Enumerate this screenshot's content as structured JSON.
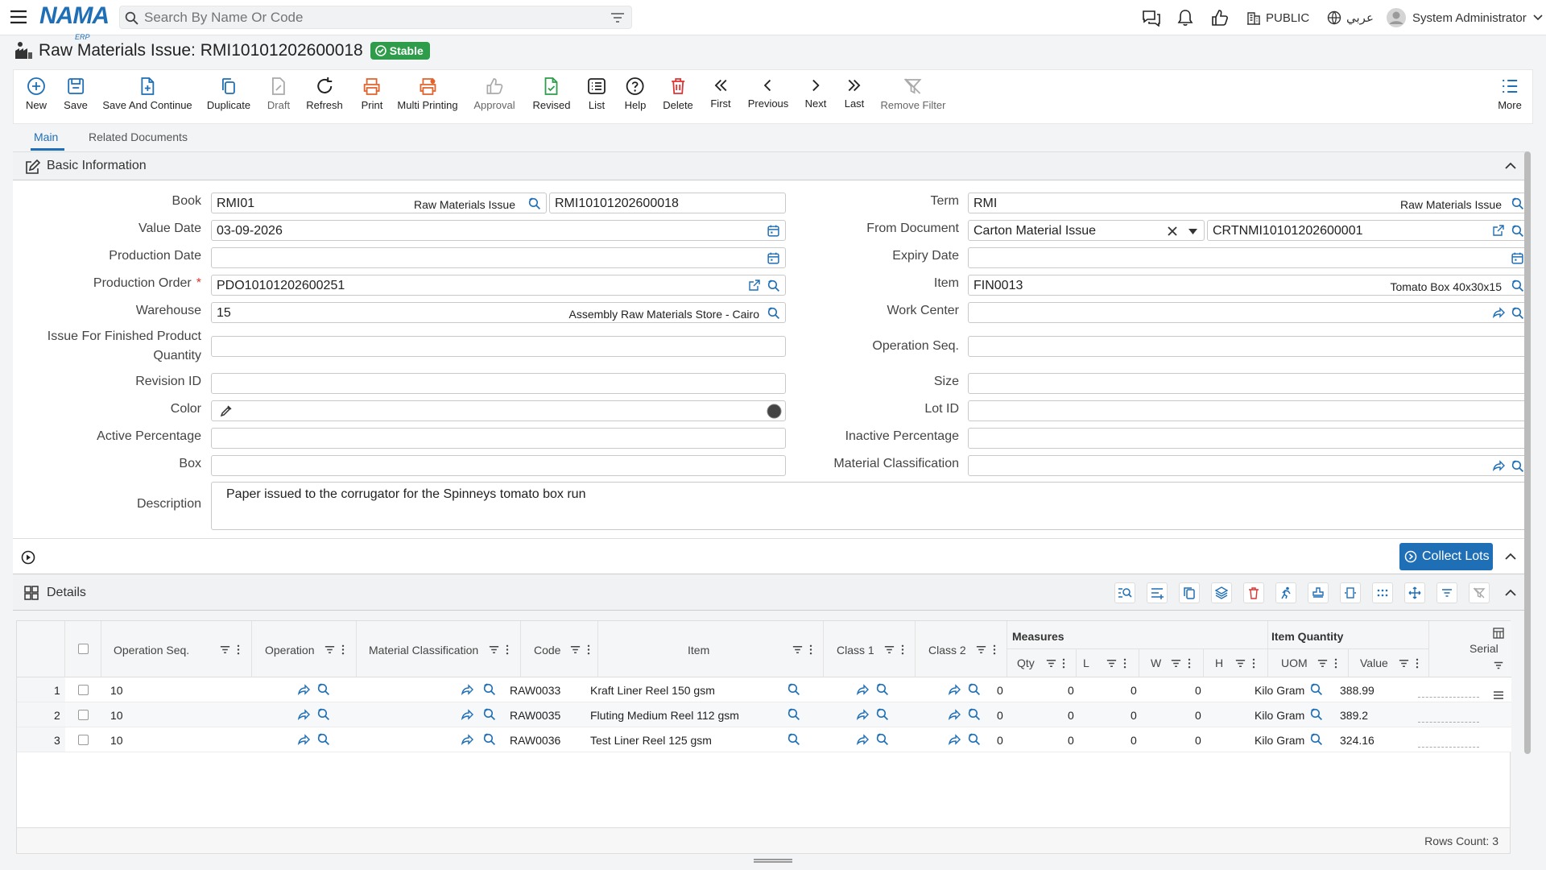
{
  "header": {
    "logo": "NAMA",
    "logo_sub": "ERP",
    "search_placeholder": "Search By Name Or Code",
    "company": "PUBLIC",
    "language": "عربي",
    "user": "System Administrator"
  },
  "page": {
    "title": "Raw Materials Issue: RMI10101202600018",
    "status": "Stable"
  },
  "toolbar": {
    "new": "New",
    "save": "Save",
    "save_continue": "Save And Continue",
    "duplicate": "Duplicate",
    "draft": "Draft",
    "refresh": "Refresh",
    "print": "Print",
    "multi_printing": "Multi Printing",
    "approval": "Approval",
    "revised": "Revised",
    "list": "List",
    "help": "Help",
    "delete": "Delete",
    "first": "First",
    "previous": "Previous",
    "next": "Next",
    "last": "Last",
    "remove_filter": "Remove Filter",
    "more": "More"
  },
  "tabs": {
    "main": "Main",
    "related": "Related Documents"
  },
  "basic": {
    "section_title": "Basic Information",
    "book_label": "Book",
    "book_code": "RMI01",
    "book_name": "Raw Materials Issue",
    "book_number": "RMI10101202600018",
    "value_date_label": "Value Date",
    "value_date": "03-09-2026",
    "production_date_label": "Production Date",
    "production_order_label": "Production Order",
    "production_order": "PDO10101202600251",
    "warehouse_label": "Warehouse",
    "warehouse_code": "15",
    "warehouse_name": "Assembly Raw Materials Store - Cairo",
    "issue_qty_label_1": "Issue For Finished Product",
    "issue_qty_label_2": "Quantity",
    "revision_label": "Revision ID",
    "color_label": "Color",
    "active_pct_label": "Active Percentage",
    "box_label": "Box",
    "description_label": "Description",
    "description": "Paper issued to the corrugator for the Spinneys tomato box run",
    "term_label": "Term",
    "term_code": "RMI",
    "term_name": "Raw Materials Issue",
    "from_doc_label": "From Document",
    "from_doc_type": "Carton Material Issue",
    "from_doc_number": "CRTNMI10101202600001",
    "expiry_label": "Expiry Date",
    "item_label": "Item",
    "item_code": "FIN0013",
    "item_name": "Tomato Box 40x30x15",
    "work_center_label": "Work Center",
    "op_seq_label": "Operation Seq.",
    "size_label": "Size",
    "lot_label": "Lot ID",
    "inactive_pct_label": "Inactive Percentage",
    "material_class_label": "Material Classification"
  },
  "collect_lots": "Collect Lots",
  "details": {
    "title": "Details",
    "columns": {
      "op_seq": "Operation Seq.",
      "operation": "Operation",
      "material_class": "Material Classification",
      "code": "Code",
      "item": "Item",
      "class1": "Class 1",
      "class2": "Class 2",
      "measures": "Measures",
      "qty": "Qty",
      "l": "L",
      "w": "W",
      "h": "H",
      "item_quantity": "Item Quantity",
      "uom": "UOM",
      "value": "Value",
      "serial": "Serial"
    },
    "rows": [
      {
        "n": "1",
        "op_seq": "10",
        "code": "RAW0033",
        "item": "Kraft Liner Reel 150 gsm",
        "qty": "0",
        "l": "0",
        "w": "0",
        "h": "0",
        "uom": "Kilo Gram",
        "value": "388.99"
      },
      {
        "n": "2",
        "op_seq": "10",
        "code": "RAW0035",
        "item": "Fluting Medium Reel 112 gsm",
        "qty": "0",
        "l": "0",
        "w": "0",
        "h": "0",
        "uom": "Kilo Gram",
        "value": "389.2"
      },
      {
        "n": "3",
        "op_seq": "10",
        "code": "RAW0036",
        "item": "Test Liner Reel 125 gsm",
        "qty": "0",
        "l": "0",
        "w": "0",
        "h": "0",
        "uom": "Kilo Gram",
        "value": "324.16"
      }
    ],
    "rows_count": "Rows Count: 3"
  }
}
